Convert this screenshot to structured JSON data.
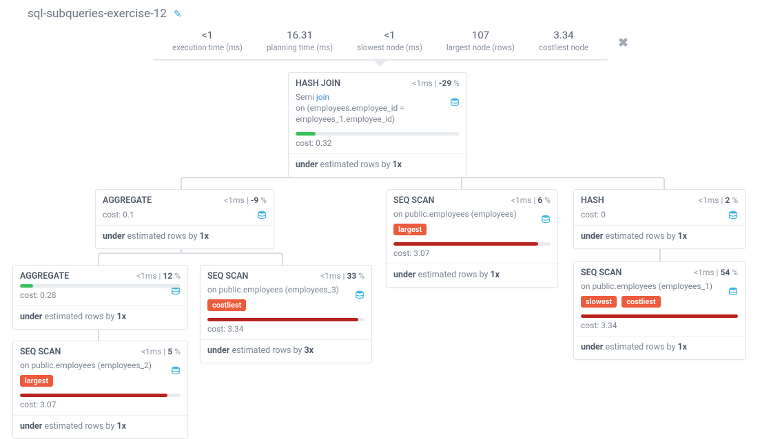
{
  "title": "sql-subqueries-exercise-12",
  "stats": {
    "exec_time": {
      "val": "<1",
      "lbl": "execution time (ms)"
    },
    "plan_time": {
      "val": "16.31",
      "lbl": "planning time (ms)"
    },
    "slowest": {
      "val": "<1",
      "lbl": "slowest node (ms)"
    },
    "largest": {
      "val": "107",
      "lbl": "largest node (rows)"
    },
    "costliest": {
      "val": "3.34",
      "lbl": "costliest node"
    }
  },
  "labels": {
    "cost": "cost:",
    "under": "under",
    "est_rows": "estimated rows by",
    "slowest": "slowest",
    "costliest": "costliest",
    "largest": "largest",
    "ms_pipe": " | "
  },
  "nodes": {
    "hashjoin": {
      "title": "HASH JOIN",
      "time": "<1ms",
      "pct": "-29",
      "pct_suffix": " %",
      "sub_prefix": "Semi ",
      "join": "join",
      "sub_on": "on (employees.employee_id = employees_1.employee_id)",
      "cost": "0.32",
      "byx": "1x"
    },
    "agg1": {
      "title": "AGGREGATE",
      "time": "<1ms",
      "pct": "-9",
      "pct_suffix": " %",
      "cost": "0.1",
      "byx": "1x"
    },
    "seqscan_emp": {
      "title": "SEQ SCAN",
      "time": "<1ms",
      "pct": "6",
      "pct_suffix": " %",
      "on": "on public.employees (employees)",
      "cost": "3.07",
      "byx": "1x"
    },
    "hash": {
      "title": "HASH",
      "time": "<1ms",
      "pct": "2",
      "pct_suffix": " %",
      "cost": "0",
      "byx": "1x"
    },
    "agg2": {
      "title": "AGGREGATE",
      "time": "<1ms",
      "pct": "12",
      "pct_suffix": " %",
      "cost": "0.28",
      "byx": "1x"
    },
    "seqscan_e3": {
      "title": "SEQ SCAN",
      "time": "<1ms",
      "pct": "33",
      "pct_suffix": " %",
      "on": "on public.employees (employees_3)",
      "cost": "3.34",
      "byx": "3x"
    },
    "seqscan_e1": {
      "title": "SEQ SCAN",
      "time": "<1ms",
      "pct": "54",
      "pct_suffix": " %",
      "on": "on public.employees (employees_1)",
      "cost": "3.34",
      "byx": "1x"
    },
    "seqscan_e2": {
      "title": "SEQ SCAN",
      "time": "<1ms",
      "pct": "5",
      "pct_suffix": " %",
      "on": "on public.employees (employees_2)",
      "cost": "3.07",
      "byx": "1x"
    }
  }
}
